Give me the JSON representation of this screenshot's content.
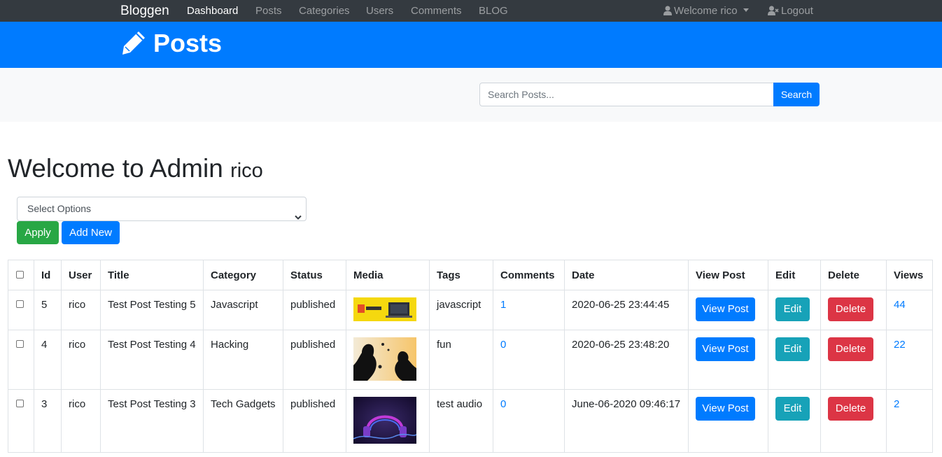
{
  "navbar": {
    "brand": "Bloggen",
    "links": [
      "Dashboard",
      "Posts",
      "Categories",
      "Users",
      "Comments",
      "BLOG"
    ],
    "user_menu": "Welcome rico",
    "logout": "Logout"
  },
  "header": {
    "title": "Posts"
  },
  "search": {
    "placeholder": "Search Posts...",
    "button": "Search"
  },
  "welcome": {
    "heading": "Welcome to Admin",
    "username": "rico"
  },
  "bulk": {
    "select_value": "Select Options",
    "apply": "Apply",
    "add_new": "Add New"
  },
  "table": {
    "headers": [
      "Id",
      "User",
      "Title",
      "Category",
      "Status",
      "Media",
      "Tags",
      "Comments",
      "Date",
      "View Post",
      "Edit",
      "Delete",
      "Views"
    ],
    "rows": [
      {
        "id": "5",
        "user": "rico",
        "title": "Test Post Testing 5",
        "category": "Javascript",
        "status": "published",
        "media": "javascript-thumbnail",
        "tags": "javascript",
        "comments": "1",
        "date": "2020-06-25 23:44:45",
        "view": "View Post",
        "edit": "Edit",
        "delete": "Delete",
        "views": "44"
      },
      {
        "id": "4",
        "user": "rico",
        "title": "Test Post Testing 4",
        "category": "Hacking",
        "status": "published",
        "media": "silhouettes-thumbnail",
        "tags": "fun",
        "comments": "0",
        "date": "2020-06-25 23:48:20",
        "view": "View Post",
        "edit": "Edit",
        "delete": "Delete",
        "views": "22"
      },
      {
        "id": "3",
        "user": "rico",
        "title": "Test Post Testing 3",
        "category": "Tech Gadgets",
        "status": "published",
        "media": "headphones-thumbnail",
        "tags": "test audio",
        "comments": "0",
        "date": "June-06-2020 09:46:17",
        "view": "View Post",
        "edit": "Edit",
        "delete": "Delete",
        "views": "2"
      }
    ]
  },
  "colors": {
    "navbar": "#343a40",
    "primary": "#007bff",
    "success": "#28a745",
    "info": "#17a2b8",
    "danger": "#dc3545"
  }
}
